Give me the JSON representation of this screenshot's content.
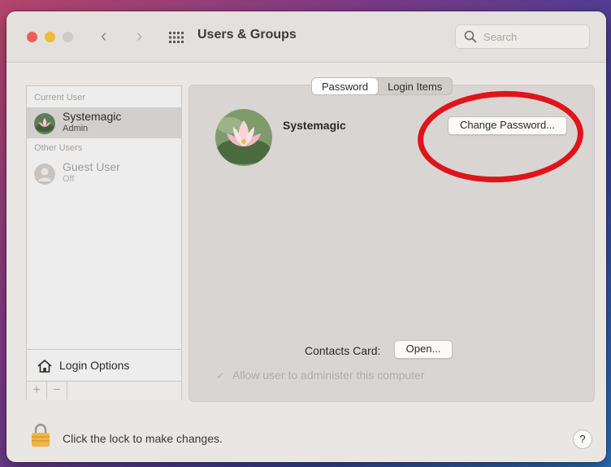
{
  "window": {
    "title": "Users & Groups",
    "search_placeholder": "Search"
  },
  "sidebar": {
    "current_user_label": "Current User",
    "other_users_label": "Other Users",
    "users": [
      {
        "name": "Systemagic",
        "role": "Admin"
      },
      {
        "name": "Guest User",
        "role": "Off"
      }
    ],
    "login_options": "Login Options",
    "add_symbol": "+",
    "remove_symbol": "−"
  },
  "tabs": [
    {
      "label": "Password",
      "active": true
    },
    {
      "label": "Login Items",
      "active": false
    }
  ],
  "detail": {
    "user_name": "Systemagic",
    "change_password_label": "Change Password...",
    "contacts_card_label": "Contacts Card:",
    "open_label": "Open...",
    "allow_admin_label": "Allow user to administer this computer",
    "allow_admin_checked": true
  },
  "footer": {
    "lock_text": "Click the lock to make changes.",
    "help_label": "?"
  },
  "colors": {
    "annotation_circle": "#e0141a",
    "close": "#ec5f58",
    "minimize": "#f1bb3a",
    "lock": "#f0b44a"
  }
}
